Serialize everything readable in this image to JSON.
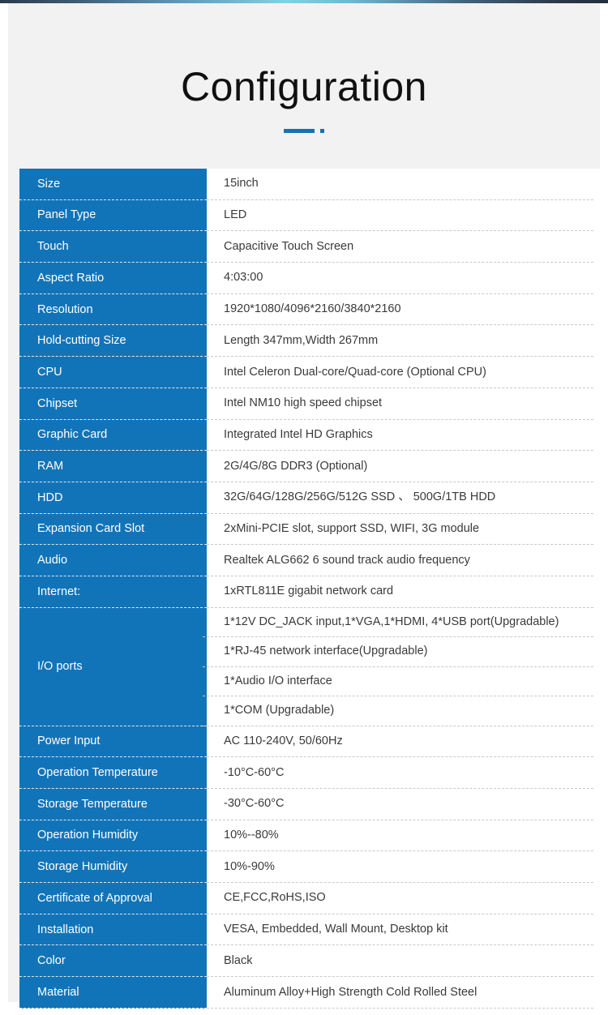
{
  "header": {
    "title": "Configuration",
    "divider_color": "#1274b8"
  },
  "theme": {
    "label_background": "#1274b8",
    "label_text": "#ffffff",
    "value_text": "#3a3a3a",
    "page_background": "#f2f2f2",
    "table_background": "#ffffff"
  },
  "spec_table": {
    "rows": [
      {
        "label": "Size",
        "value": "15inch"
      },
      {
        "label": "Panel Type",
        "value": "LED"
      },
      {
        "label": "Touch",
        "value": "Capacitive Touch Screen"
      },
      {
        "label": "Aspect Ratio",
        "value": "4:03:00"
      },
      {
        "label": "Resolution",
        "value": "1920*1080/4096*2160/3840*2160"
      },
      {
        "label": "Hold-cutting Size",
        "value": "Length 347mm,Width 267mm"
      },
      {
        "label": "CPU",
        "value": "Intel Celeron Dual-core/Quad-core (Optional CPU)"
      },
      {
        "label": "Chipset",
        "value": "Intel NM10  high speed chipset"
      },
      {
        "label": "Graphic Card",
        "value": "Integrated Intel HD Graphics"
      },
      {
        "label": "RAM",
        "value": "2G/4G/8G DDR3 (Optional)"
      },
      {
        "label": "HDD",
        "value": "32G/64G/128G/256G/512G SSD 、 500G/1TB HDD"
      },
      {
        "label": "Expansion Card Slot",
        "value": "2xMini-PCIE slot, support SSD, WIFI, 3G module"
      },
      {
        "label": "Audio",
        "value": "Realtek ALG662 6 sound track audio frequency"
      },
      {
        "label": "Internet:",
        "value": "1xRTL811E gigabit network card"
      }
    ],
    "io_ports": {
      "label": "I/O ports",
      "values": [
        "1*12V DC_JACK input,1*VGA,1*HDMI, 4*USB  port(Upgradable)",
        "1*RJ-45 network interface(Upgradable)",
        "1*Audio I/O interface",
        "1*COM (Upgradable)"
      ]
    },
    "rows_after": [
      {
        "label": "Power Input",
        "value": "AC 110-240V, 50/60Hz"
      },
      {
        "label": "Operation Temperature",
        "value": "-10°C-60°C"
      },
      {
        "label": "Storage Temperature",
        "value": "-30°C-60°C"
      },
      {
        "label": "Operation Humidity",
        "value": "10%--80%"
      },
      {
        "label": "Storage Humidity",
        "value": "10%-90%"
      },
      {
        "label": "Certificate of Approval",
        "value": "CE,FCC,RoHS,ISO"
      },
      {
        "label": "Installation",
        "value": "VESA, Embedded, Wall Mount, Desktop kit"
      },
      {
        "label": "Color",
        "value": "Black"
      },
      {
        "label": "Material",
        "value": "Aluminum Alloy+High Strength Cold Rolled Steel"
      }
    ]
  }
}
